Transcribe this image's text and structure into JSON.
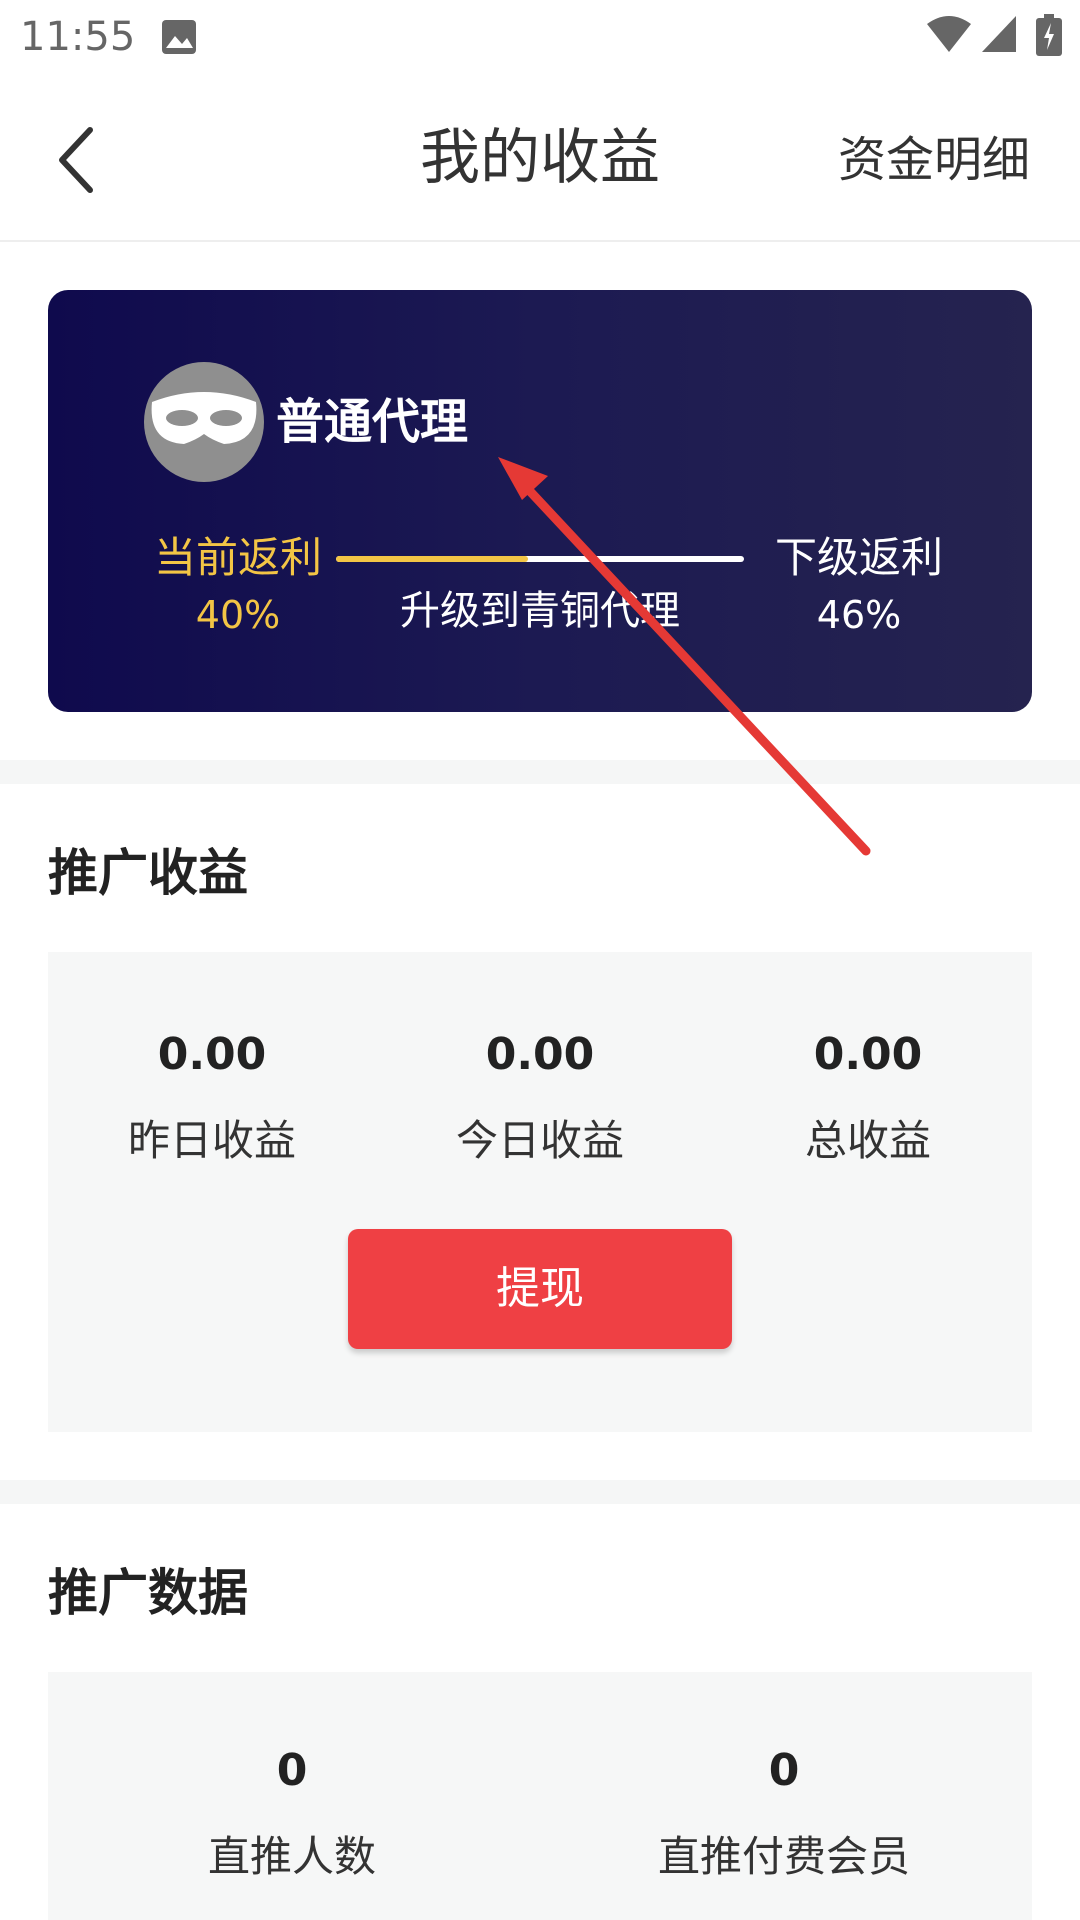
{
  "status_bar": {
    "time": "11:55"
  },
  "header": {
    "title": "我的收益",
    "detail_link": "资金明细"
  },
  "agent_card": {
    "level": "普通代理",
    "current_rebate_label": "当前返利",
    "current_rebate_value": "40%",
    "upgrade_text": "升级到青铜代理",
    "next_rebate_label": "下级返利",
    "next_rebate_value": "46%",
    "progress_fraction": 0.47
  },
  "promo_earnings": {
    "title": "推广收益",
    "stats": [
      {
        "value": "0.00",
        "label": "昨日收益"
      },
      {
        "value": "0.00",
        "label": "今日收益"
      },
      {
        "value": "0.00",
        "label": "总收益"
      }
    ],
    "withdraw_label": "提现"
  },
  "promo_data": {
    "title": "推广数据",
    "stats": [
      {
        "value": "0",
        "label": "直推人数"
      },
      {
        "value": "0",
        "label": "直推付费会员"
      }
    ]
  },
  "colors": {
    "accent_gold": "#f3c545",
    "button_red": "#ef4044",
    "card_dark": "#0f0a4d",
    "annotation_red": "#e53935"
  }
}
